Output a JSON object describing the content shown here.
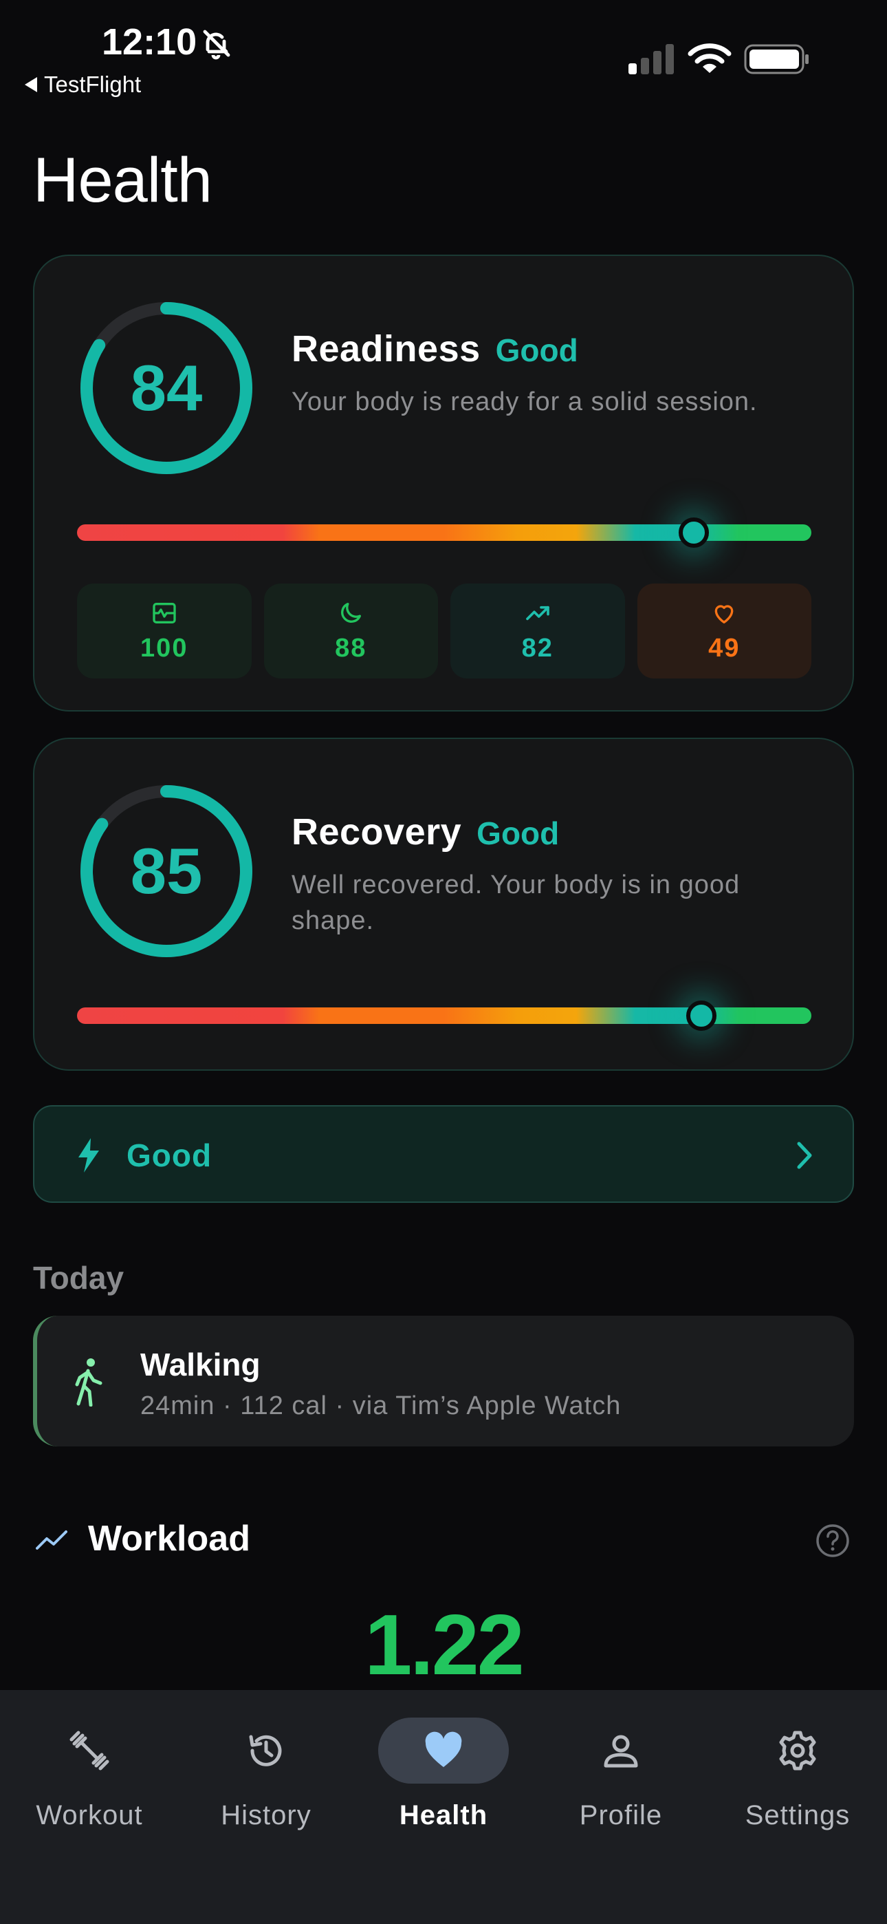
{
  "status_bar": {
    "time": "12:10",
    "back_app": "TestFlight"
  },
  "page": {
    "title": "Health"
  },
  "readiness": {
    "score": "84",
    "score_fraction": 0.84,
    "title": "Readiness",
    "status": "Good",
    "description": "Your body is ready for a solid session.",
    "gauge_position": 0.84,
    "metrics": [
      {
        "icon": "heart-monitor-icon",
        "value": "100"
      },
      {
        "icon": "moon-icon",
        "value": "88"
      },
      {
        "icon": "trend-up-icon",
        "value": "82"
      },
      {
        "icon": "heart-icon",
        "value": "49"
      }
    ]
  },
  "recovery": {
    "score": "85",
    "score_fraction": 0.85,
    "title": "Recovery",
    "status": "Good",
    "description": "Well recovered. Your body is in good shape.",
    "gauge_position": 0.85
  },
  "status_pill": {
    "label": "Good"
  },
  "today": {
    "heading": "Today",
    "activity": {
      "title": "Walking",
      "subtitle": "24min · 112 cal · via Tim’s Apple Watch"
    }
  },
  "workload": {
    "title": "Workload",
    "value": "1.22"
  },
  "tabs": [
    {
      "label": "Workout",
      "icon": "dumbbell-icon",
      "active": false
    },
    {
      "label": "History",
      "icon": "history-icon",
      "active": false
    },
    {
      "label": "Health",
      "icon": "heart-icon",
      "active": true
    },
    {
      "label": "Profile",
      "icon": "person-icon",
      "active": false
    },
    {
      "label": "Settings",
      "icon": "gear-icon",
      "active": false
    }
  ],
  "colors": {
    "accent": "#14b8a6",
    "good_green": "#22c55e",
    "warning_orange": "#f97316",
    "background": "#0a0a0c"
  }
}
